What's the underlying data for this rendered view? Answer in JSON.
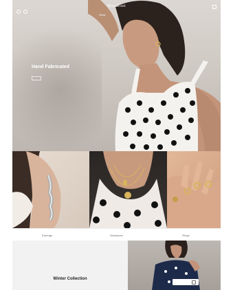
{
  "nav": {
    "brand": "Broadcast",
    "links": [
      "Home",
      "",
      "",
      ""
    ]
  },
  "hero": {
    "title": "Hand Fabricated",
    "subtitle": "",
    "button_label": ""
  },
  "categories": [
    "Earrings",
    "Necklaces",
    "Rings"
  ],
  "collection": {
    "title": "Winter Collection",
    "subtitle": "",
    "shop_label": ""
  },
  "icons": [
    "search-icon",
    "account-icon",
    "cart-icon",
    "arrow-right-icon"
  ],
  "colors": {
    "hero_bg": "#cfc9c3",
    "polka_dot": "#111111",
    "panel_bg": "#f2f2f2"
  }
}
